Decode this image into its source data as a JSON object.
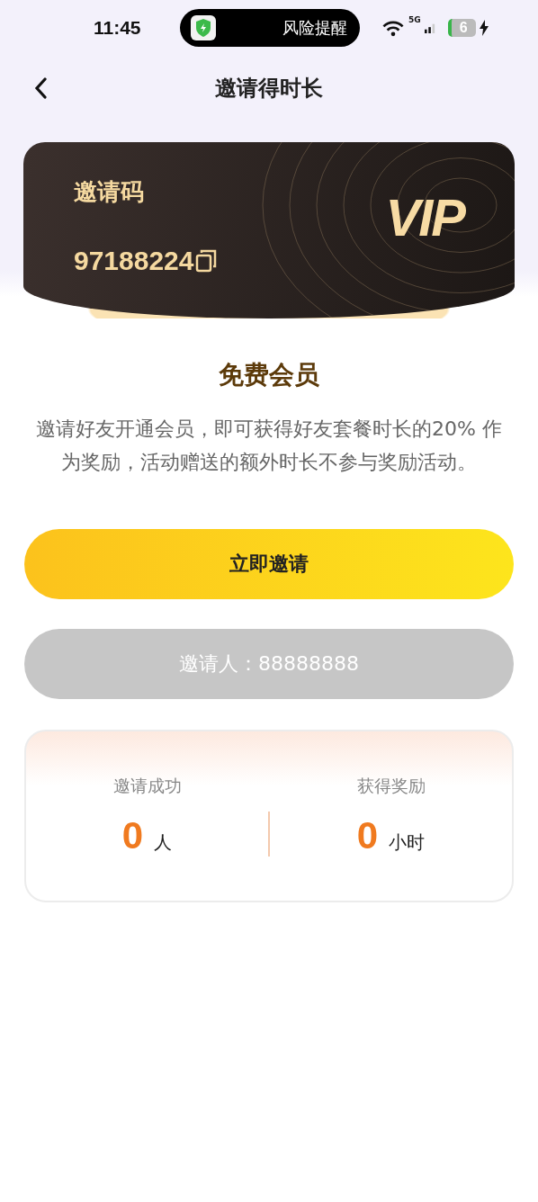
{
  "status_bar": {
    "time": "11:45",
    "alert": {
      "text": "风险提醒"
    },
    "network": "5G",
    "battery": "6",
    "charging": true
  },
  "header": {
    "title": "邀请得时长"
  },
  "vip_card": {
    "label": "邀请码",
    "code": "97188224",
    "badge": "VIP"
  },
  "intro": {
    "title": "免费会员",
    "text": "邀请好友开通会员，即可获得好友套餐时长的20% 作为奖励，活动赠送的额外时长不参与奖励活动。"
  },
  "invite_button": {
    "label": "立即邀请"
  },
  "inviter": {
    "text": "邀请人：88888888"
  },
  "stats": [
    {
      "label": "邀请成功",
      "value": "0",
      "unit": "人"
    },
    {
      "label": "获得奖励",
      "value": "0",
      "unit": "小时"
    }
  ]
}
